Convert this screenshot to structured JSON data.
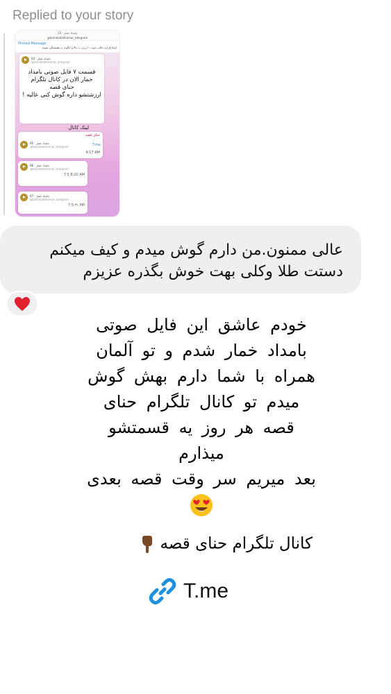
{
  "header": {
    "replied_label": "Replied to your story"
  },
  "story": {
    "top_title": "بامداد خمار - 23",
    "top_handle": "@bamdadekhamar_telegram",
    "pinned_label": "Pinned Message",
    "pinned_text": "اینجا قراره حالت خوب - انرژی ت بالا و انگیزه ت همیشگی بمونه",
    "audio1_title": "بامداد خمار - 03",
    "audio1_handle": "@bamdadkhamar_telegram",
    "big_text_1": "قسمت ۷ فایل صوتی بامداد",
    "big_text_2": "خمار الان در کانال تلگرام",
    "big_text_3": "حنای قصه",
    "big_text_4": "ارزشتشو داره گوش کنی عالیه !",
    "link_caption": "لینک کانال",
    "link_label": "T.me",
    "sender": "حنای قصه",
    "audio2_title": "بامداد خمار - 05",
    "audio2_handle": "@bamdadkhamar_telegram",
    "audio3_title": "بامداد خمار - 06",
    "audio3_handle": "@bamdadkhamar_telegram",
    "audio4_title": "بامداد خمار - 07",
    "audio4_handle": "@bamdadkhamar_telegram",
    "time1": "9:17 AM",
    "time2": "7:5 8:20 AM",
    "time3": "7:5 ٣١ PM"
  },
  "message": {
    "line1": "عالی ممنون.من دارم گوش میدم و کیف میکنم",
    "line2": "دستت طلا وکلی بهت خوش بگذره عزیزم"
  },
  "reaction": {
    "icon": "red-heart"
  },
  "reply": {
    "line1": "خودم عاشق این فایل صوتی",
    "line2": "بامداد خمار شدم و تو آلمان",
    "line3": "همراه با شما دارم بهش گوش",
    "line4": "میدم تو کانال تلگرام حنای",
    "line5": "قصه هر روز یه قسمتشو",
    "line6": "میذارم",
    "line7": "بعد میریم سر وقت قصه بعدی",
    "channel_line": "کانال تلگرام حنای قصه",
    "link_text": "T.me"
  },
  "colors": {
    "accent_blue": "#1f8fe0",
    "bubble_gray": "#efefef",
    "heart_red": "#e0202f"
  }
}
